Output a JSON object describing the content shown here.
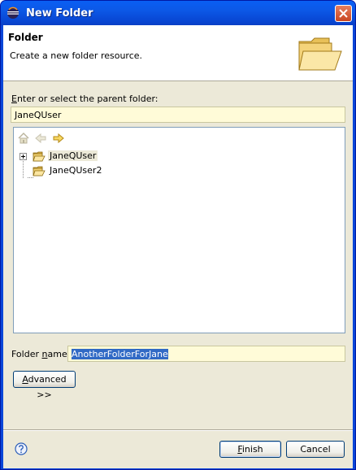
{
  "window": {
    "title": "New Folder"
  },
  "banner": {
    "title": "Folder",
    "description": "Create a new folder resource."
  },
  "parent": {
    "label_pre": "",
    "label_accel": "E",
    "label_post": "nter or select the parent folder:",
    "value": "JaneQUser"
  },
  "tree": {
    "items": [
      {
        "label": "JaneQUser",
        "expandable": true
      },
      {
        "label": "JaneQUser2",
        "expandable": false
      }
    ]
  },
  "folder_name": {
    "label_pre": "Folder ",
    "label_accel": "n",
    "label_post": "ame:",
    "value": "AnotherFolderForJane"
  },
  "advanced": {
    "pre": "",
    "accel": "A",
    "post": "dvanced >>"
  },
  "buttons": {
    "finish": {
      "pre": "",
      "accel": "F",
      "post": "inish"
    },
    "cancel": "Cancel"
  },
  "icons": {
    "title": "eclipse-icon",
    "banner": "folder-large-icon",
    "home": "home-icon",
    "back": "back-arrow-icon",
    "forward": "forward-arrow-icon",
    "help": "help-icon"
  },
  "colors": {
    "titlebar": "#0a5ff4",
    "field_bg": "#fffbd8",
    "selection": "#316ac5",
    "dialog_bg": "#ece9d8"
  }
}
